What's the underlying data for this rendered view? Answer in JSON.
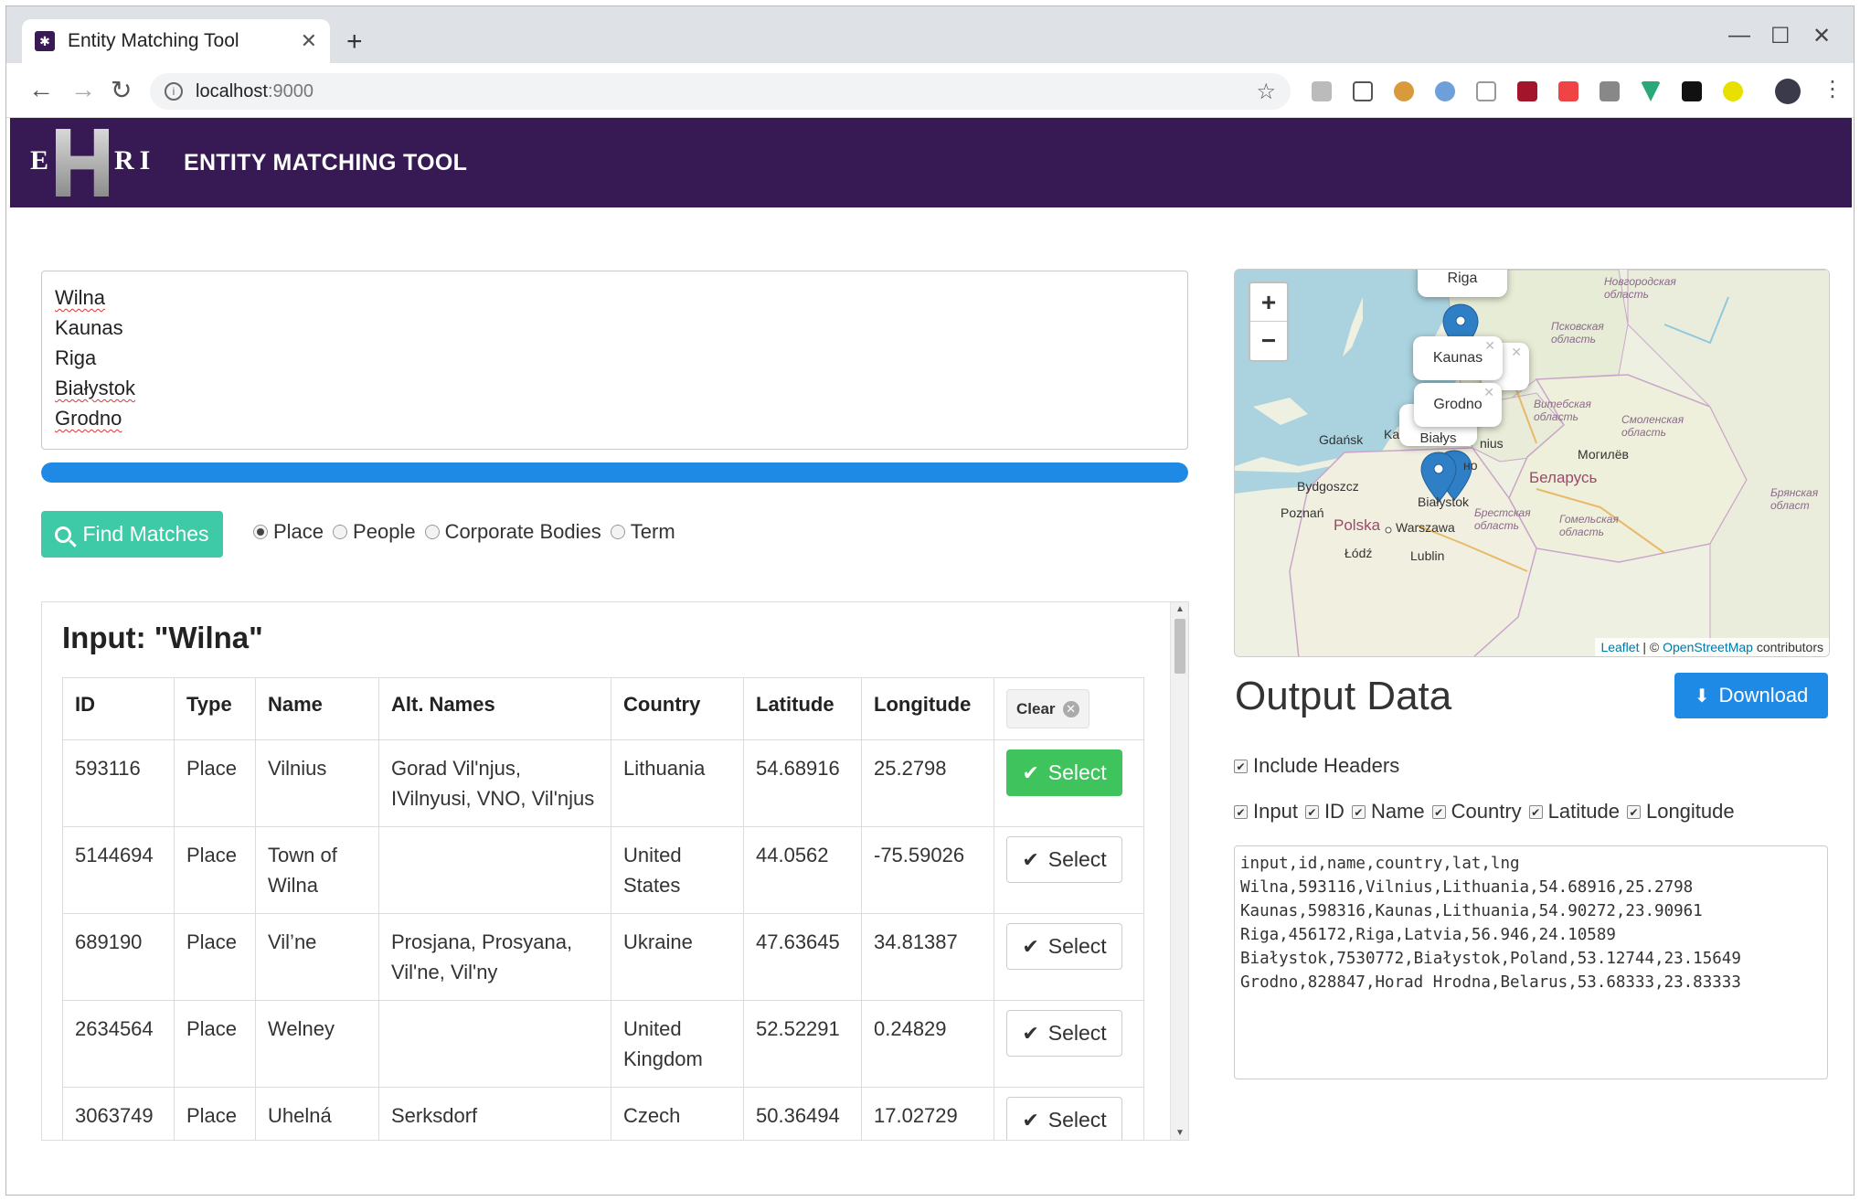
{
  "browser": {
    "tab_title": "Entity Matching Tool",
    "url_host": "localhost",
    "url_port": ":9000"
  },
  "header": {
    "logo_e": "E",
    "logo_ri": "RI",
    "title": "ENTITY MATCHING TOOL"
  },
  "input": {
    "lines": [
      "Wilna",
      "Kaunas",
      "Riga",
      "Białystok",
      "Grodno"
    ]
  },
  "progress": {
    "percent": 100
  },
  "controls": {
    "find_label": "Find Matches",
    "radios": [
      {
        "label": "Place",
        "checked": true
      },
      {
        "label": "People",
        "checked": false
      },
      {
        "label": "Corporate Bodies",
        "checked": false
      },
      {
        "label": "Term",
        "checked": false
      }
    ]
  },
  "results": {
    "heading": "Input: \"Wilna\"",
    "columns": [
      "ID",
      "Type",
      "Name",
      "Alt. Names",
      "Country",
      "Latitude",
      "Longitude"
    ],
    "clear_label": "Clear",
    "select_label": "Select",
    "rows": [
      {
        "id": "593116",
        "type": "Place",
        "name": "Vilnius",
        "alt": "Gorad Vil'njus, IVilnyusi, VNO, Vil'njus",
        "country": "Lithuania",
        "lat": "54.68916",
        "lng": "25.2798",
        "selected": true
      },
      {
        "id": "5144694",
        "type": "Place",
        "name": "Town of Wilna",
        "alt": "",
        "country": "United States",
        "lat": "44.0562",
        "lng": "-75.59026",
        "selected": false
      },
      {
        "id": "689190",
        "type": "Place",
        "name": "Vil’ne",
        "alt": "Prosjana, Prosyana, Vil'ne, Vil'ny",
        "country": "Ukraine",
        "lat": "47.63645",
        "lng": "34.81387",
        "selected": false
      },
      {
        "id": "2634564",
        "type": "Place",
        "name": "Welney",
        "alt": "",
        "country": "United Kingdom",
        "lat": "52.52291",
        "lng": "0.24829",
        "selected": false
      },
      {
        "id": "3063749",
        "type": "Place",
        "name": "Uhelná",
        "alt": "Serksdorf",
        "country": "Czech",
        "lat": "50.36494",
        "lng": "17.02729",
        "selected": false
      }
    ]
  },
  "map": {
    "popups": [
      "Riga",
      "Kaunas",
      "Grodno",
      "Białys"
    ],
    "labels": {
      "gdansk": "Gdańsk",
      "bydgoszcz": "Bydgoszcz",
      "poznan": "Poznań",
      "polska": "Polska",
      "warszawa": "Warszawa",
      "lodz": "Łódź",
      "lublin": "Lublin",
      "bialystok": "Białystok",
      "belarus": "Беларусь",
      "mogilev": "Могилёв",
      "vitebsk": "Витебская область",
      "smolensk": "Смоленская область",
      "pskov": "Псковская область",
      "novgorod": "Новгородская область",
      "brest": "Брестская область",
      "gomel": "Гомельская область",
      "bryansk": "Брянская област",
      "nius": "nius",
      "ka": "Ka",
      "no": "но"
    },
    "attribution": {
      "leaflet": "Leaflet",
      "sep": " | © ",
      "osm": "OpenStreetMap",
      "suffix": " contributors"
    },
    "colors": {
      "water": "#aad3df",
      "land": "#eef0e1",
      "marker": "#2f7fc6"
    }
  },
  "output": {
    "title": "Output Data",
    "download_label": "Download",
    "include_headers": "Include Headers",
    "fields": [
      "Input",
      "ID",
      "Name",
      "Country",
      "Latitude",
      "Longitude"
    ],
    "csv": "input,id,name,country,lat,lng\nWilna,593116,Vilnius,Lithuania,54.68916,25.2798\nKaunas,598316,Kaunas,Lithuania,54.90272,23.90961\nRiga,456172,Riga,Latvia,56.946,24.10589\nBiałystok,7530772,Białystok,Poland,53.12744,23.15649\nGrodno,828847,Horad Hrodna,Belarus,53.68333,23.83333"
  }
}
